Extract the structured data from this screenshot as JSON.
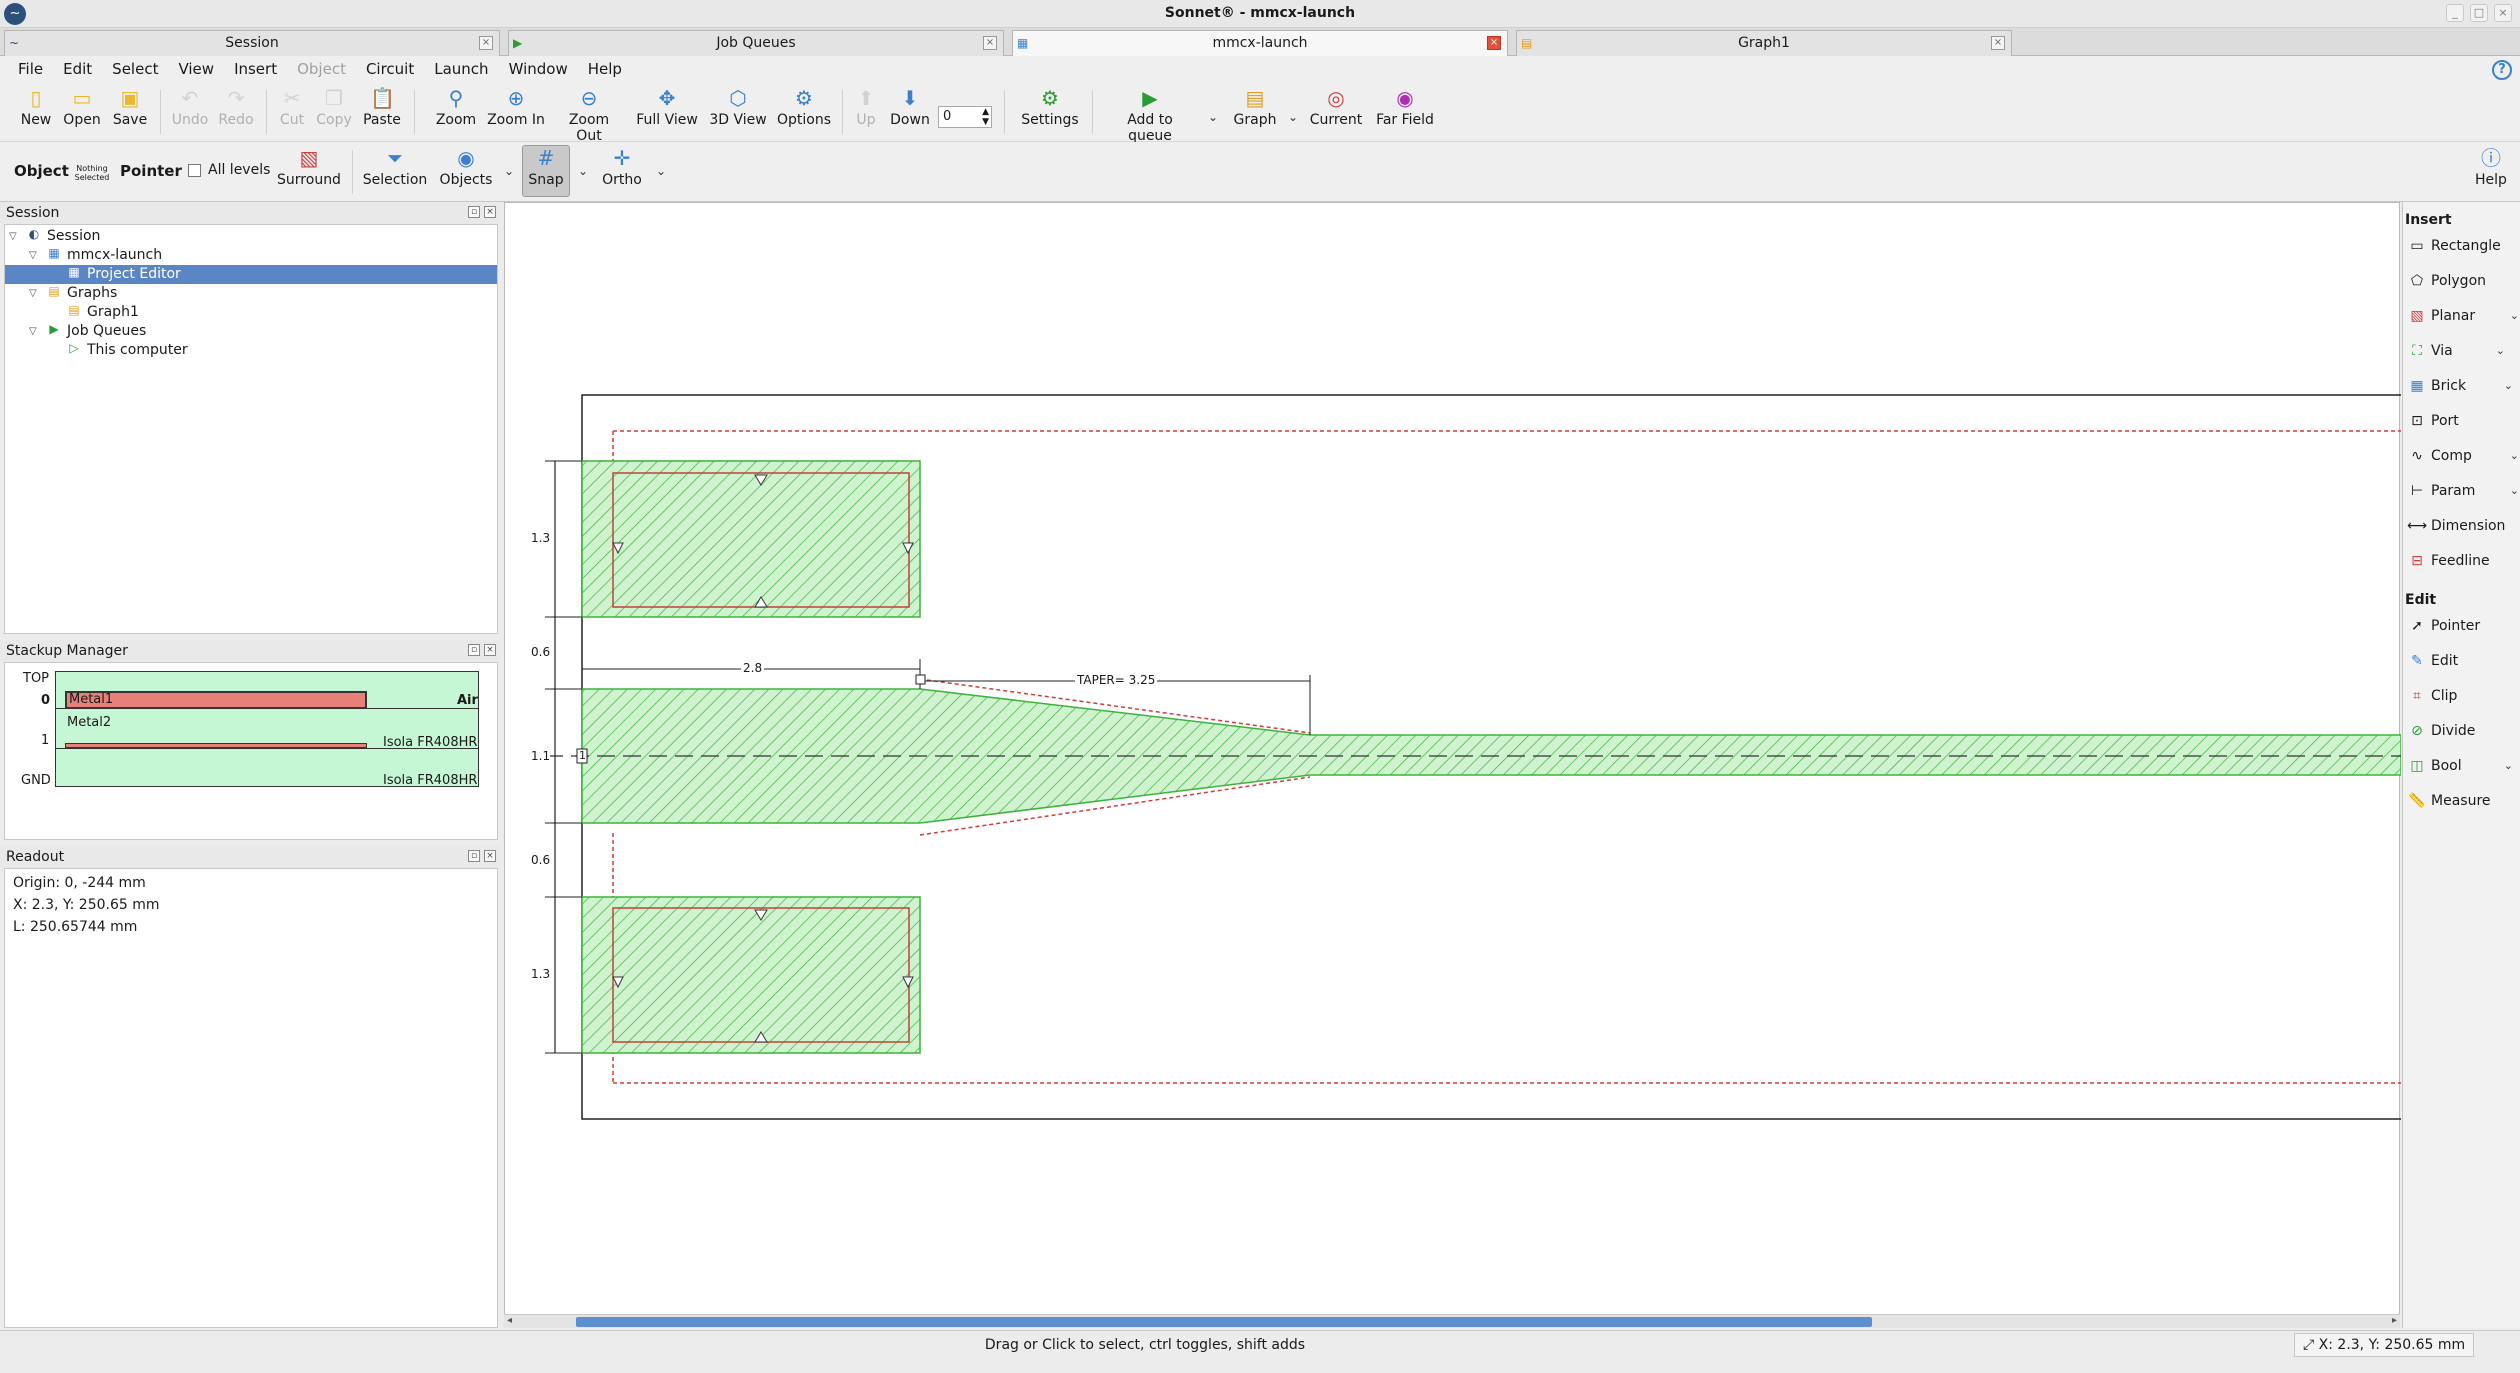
{
  "window": {
    "title": "Sonnet® - mmcx-launch"
  },
  "doc_tabs": [
    {
      "label": "Session",
      "icon": "session-icon"
    },
    {
      "label": "Job Queues",
      "icon": "job-queue-icon"
    },
    {
      "label": "mmcx-launch",
      "icon": "project-editor-icon"
    },
    {
      "label": "Graph1",
      "icon": "graph-icon"
    }
  ],
  "menu": [
    "File",
    "Edit",
    "Select",
    "View",
    "Insert",
    "Object",
    "Circuit",
    "Launch",
    "Window",
    "Help"
  ],
  "toolbar1": {
    "new": "New",
    "open": "Open",
    "save": "Save",
    "undo": "Undo",
    "redo": "Redo",
    "cut": "Cut",
    "copy": "Copy",
    "paste": "Paste",
    "zoom": "Zoom",
    "zoom_in": "Zoom In",
    "zoom_out": "Zoom Out",
    "full_view": "Full View",
    "view3d": "3D View",
    "options": "Options",
    "up": "Up",
    "down": "Down",
    "level_value": "0",
    "settings": "Settings",
    "add_to_queue": "Add to queue",
    "graph": "Graph",
    "current": "Current",
    "far_field": "Far Field"
  },
  "toolbar2": {
    "object": "Object",
    "nothing_selected": "Nothing Selected",
    "pointer": "Pointer",
    "all_levels": "All levels",
    "surround": "Surround",
    "selection": "Selection",
    "objects": "Objects",
    "snap": "Snap",
    "ortho": "Ortho",
    "help": "Help"
  },
  "session": {
    "title": "Session",
    "tree": [
      {
        "label": "Session"
      },
      {
        "label": "mmcx-launch"
      },
      {
        "label": "Project Editor"
      },
      {
        "label": "Graphs"
      },
      {
        "label": "Graph1"
      },
      {
        "label": "Job Queues"
      },
      {
        "label": "This computer"
      }
    ]
  },
  "stackup": {
    "title": "Stackup Manager",
    "rows": [
      {
        "label": "TOP"
      },
      {
        "label": "0",
        "metal": "Metal1",
        "material": "Air"
      },
      {
        "label": "1",
        "metal": "Metal2",
        "material": "Isola FR408HR"
      },
      {
        "label": "GND",
        "material": "Isola FR408HR"
      }
    ]
  },
  "readout": {
    "title": "Readout",
    "origin": "Origin: 0, -244 mm",
    "xy": "X: 2.3, Y: 250.65 mm",
    "length": "L: 250.65744 mm"
  },
  "canvas": {
    "dim_top_gap": "1.3",
    "dim_gap1": "0.6",
    "dim_signal": "1.1",
    "dim_gap2": "0.6",
    "dim_bottom_gap": "1.3",
    "dim_width": "2.8",
    "dim_taper": "TAPER= 3.25",
    "port_label": "1",
    "colors": {
      "metal": "#2bb52b",
      "metal_fill": "#cff2cf",
      "dielectric_outline": "#d23c3c"
    }
  },
  "insert_panel": {
    "insert_head": "Insert",
    "insert_items": [
      "Rectangle",
      "Polygon",
      "Planar",
      "Via",
      "Brick",
      "Port",
      "Comp",
      "Param",
      "Dimension",
      "Feedline"
    ],
    "edit_head": "Edit",
    "edit_items": [
      "Pointer",
      "Edit",
      "Clip",
      "Divide",
      "Bool",
      "Measure"
    ]
  },
  "status": {
    "message": "Drag or Click to select, ctrl toggles, shift adds",
    "coord": "X: 2.3, Y: 250.65 mm"
  }
}
